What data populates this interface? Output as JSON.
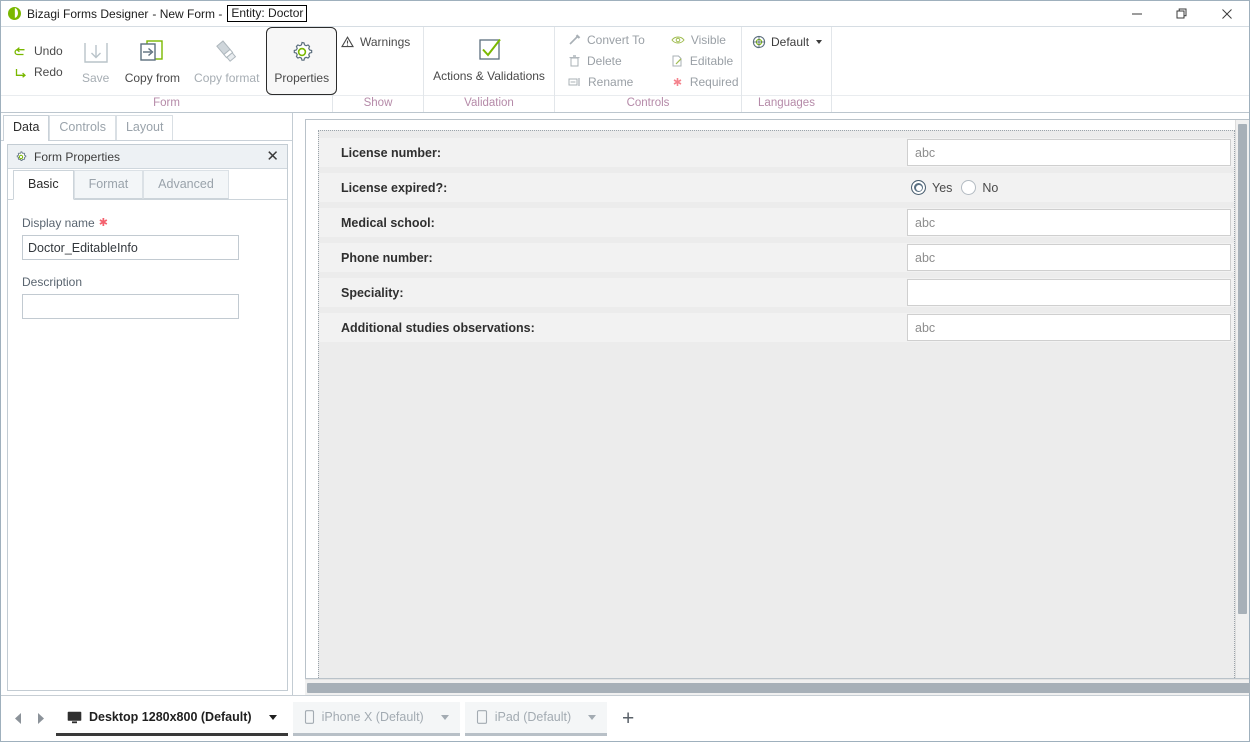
{
  "window": {
    "app_name": "Bizagi Forms Designer",
    "doc_name": "- New Form -",
    "entity_badge": "Entity:  Doctor",
    "minimize": "minimize-button",
    "restore": "restore-button",
    "close": "close-button"
  },
  "ribbon": {
    "groups": [
      {
        "label": "Form",
        "small_items": [
          {
            "label": "Undo",
            "icon": "undo-icon"
          },
          {
            "label": "Redo",
            "icon": "redo-icon"
          }
        ],
        "big_items": [
          {
            "label": "Save",
            "icon": "save-icon",
            "state": "disabled"
          },
          {
            "label": "Copy from",
            "icon": "copy-from-icon",
            "state": "normal"
          },
          {
            "label": "Copy format",
            "icon": "copy-format-icon",
            "state": "disabled"
          },
          {
            "label": "Properties",
            "icon": "gear-icon",
            "state": "selected"
          }
        ]
      },
      {
        "label": "Show",
        "small_items": [
          {
            "label": "Warnings",
            "icon": "warning-icon"
          }
        ],
        "big_items": []
      },
      {
        "label": "Validation",
        "small_items": [],
        "big_items": [
          {
            "label": "Actions & Validations",
            "icon": "checkbox-check-icon",
            "state": "normal"
          }
        ]
      },
      {
        "label": "Controls",
        "small_items": [
          {
            "label": "Convert To",
            "icon": "convert-to-icon"
          },
          {
            "label": "Delete",
            "icon": "trash-icon"
          },
          {
            "label": "Rename",
            "icon": "rename-icon"
          }
        ],
        "small_items_2": [
          {
            "label": "Visible",
            "icon": "eye-icon"
          },
          {
            "label": "Editable",
            "icon": "edit-page-icon"
          },
          {
            "label": "Required",
            "icon": "asterisk-icon"
          }
        ],
        "big_items": []
      },
      {
        "label": "Languages",
        "dropdown": {
          "label": "Default",
          "icon": "globe-icon"
        },
        "small_items": [],
        "big_items": []
      }
    ]
  },
  "left_panel": {
    "tabs": [
      {
        "label": "Data",
        "active": true
      },
      {
        "label": "Controls",
        "active": false
      },
      {
        "label": "Layout",
        "active": false
      }
    ],
    "properties": {
      "title": "Form Properties",
      "close_label": "✕",
      "tabs": [
        {
          "label": "Basic",
          "active": true
        },
        {
          "label": "Format",
          "active": false
        },
        {
          "label": "Advanced",
          "active": false
        }
      ],
      "fields": [
        {
          "label": "Display name",
          "required": true,
          "value": "Doctor_EditableInfo",
          "placeholder": ""
        },
        {
          "label": "Description",
          "required": false,
          "value": "",
          "placeholder": ""
        }
      ]
    }
  },
  "form_canvas": {
    "rows": [
      {
        "label": "License number:",
        "control": "text",
        "value": "abc"
      },
      {
        "label": "License expired?:",
        "control": "radio",
        "options": [
          {
            "label": "Yes",
            "selected": true
          },
          {
            "label": "No",
            "selected": false
          }
        ]
      },
      {
        "label": "Medical school:",
        "control": "text",
        "value": "abc"
      },
      {
        "label": "Phone number:",
        "control": "text",
        "value": "abc"
      },
      {
        "label": "Speciality:",
        "control": "text",
        "value": ""
      },
      {
        "label": "Additional studies observations:",
        "control": "text",
        "value": "abc"
      }
    ]
  },
  "bottom_bar": {
    "prev_label": "◀",
    "next_label": "▶",
    "add_label": "+",
    "device_tabs": [
      {
        "label": "Desktop 1280x800 (Default)",
        "icon": "monitor-icon",
        "active": true
      },
      {
        "label": "iPhone X (Default)",
        "icon": "phone-icon",
        "active": false
      },
      {
        "label": "iPad (Default)",
        "icon": "tablet-icon",
        "active": false
      }
    ]
  },
  "colors": {
    "brand_green": "#7ab800",
    "group_label": "#b58aa8",
    "required_red": "#f4616e",
    "radio_selected": "#5b7183"
  }
}
